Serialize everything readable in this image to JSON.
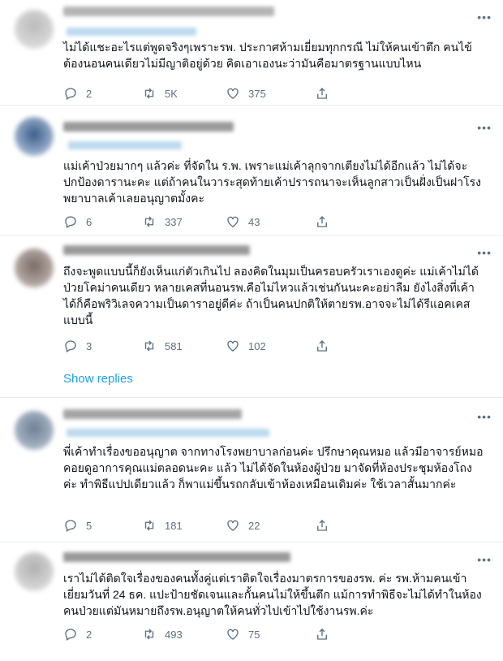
{
  "tweets": [
    {
      "text": "ไม่ได้แชะอะไรแต่พูดจริงๆเพราะรพ. ประกาศห้ามเยี่ยมทุกกรณี ไม่ให้คนเข้าตึก คนไข้ต้องนอนคนเดียวไม่มีญาติอยู่ด้วย คิดเอาเองนะว่ามันคือมาตรฐานแบบไหน",
      "replies": "2",
      "retweets": "5K",
      "likes": "375"
    },
    {
      "text": "แม่เค้าป่วยมากๆ แล้วค่ะ ที่จัดใน ร.พ. เพราะแม่เค้าลุกจากเตียงไม่ได้อีกแล้ว ไม่ได้จะปกป้องดารานะคะ แต่ถ้าคนในวาระสุดท้ายเค้าปรารถนาจะเห็นลูกสาวเป็นฝั่งเป็นฝาโรงพยาบาลเค้าเลยอนุญาตมั้งคะ",
      "replies": "6",
      "retweets": "337",
      "likes": "43"
    },
    {
      "text": "ถึงจะพูดแบบนี้ก็ยังเห็นแก่ตัวเกินไป ลองคิดในมุมเป็นครอบครัวเราเองดูค่ะ แม่เค้าไม่ได้ป่วยโคม่าคนเดียว หลายเคสที่นอนรพ.คือไม่ไหวแล้วเช่นกันนะคะอย่าลืม ยังไงสิ่งที่เค้าได้ก็คือพริวิเลจความเป็นดาราอยู่ดีค่ะ ถ้าเป็นคนปกติให้ตายรพ.อาจจะไม่ได้รีแอคเคสแบบนี้",
      "replies": "3",
      "retweets": "581",
      "likes": "102"
    },
    {
      "text": "พี่เค้าทำเรื่องขออนุญาต จากทางโรงพยาบาลก่อนค่ะ ปรึกษาคุณหมอ แล้วมีอาจารย์หมอคอยดูอาการคุณแม่ตลอดนะคะ แล้ว ไม่ได้จัดในห้องผู้ป่วย มาจัดที่ห้องประชุมห้องโถงค่ะ ทำพิธีแปปเดียวแล้ว ก็พาแม่ขึ้นรถกลับเข้าห้องเหมือนเดิมค่ะ ใช้เวลาสั้นมากค่ะ",
      "replies": "5",
      "retweets": "181",
      "likes": "22"
    },
    {
      "text": "เราไม่ได้ติดใจเรื่องของคนทั้งคู่แต่เราติดใจเรื่องมาตรการของรพ. ค่ะ รพ.ห้ามคนเข้าเยี่ยมวันที่ 24 ธค. แปะป้ายชัดเจนและกั้นคนไม่ให้ขึ้นตึก แม้การทำพิธีจะไม่ได้ทำในห้องคนป่วยแต่มันหมายถึงรพ.อนุญาตให้คนทั่วไปเข้าไปใช้งานรพ.ค่ะ",
      "replies": "2",
      "retweets": "493",
      "likes": "75"
    }
  ],
  "show_replies_label": "Show replies",
  "more_glyph": "•••",
  "colors": {
    "accent": "#1da1f2",
    "muted": "#5b7083",
    "divider": "#e6ecf0"
  }
}
